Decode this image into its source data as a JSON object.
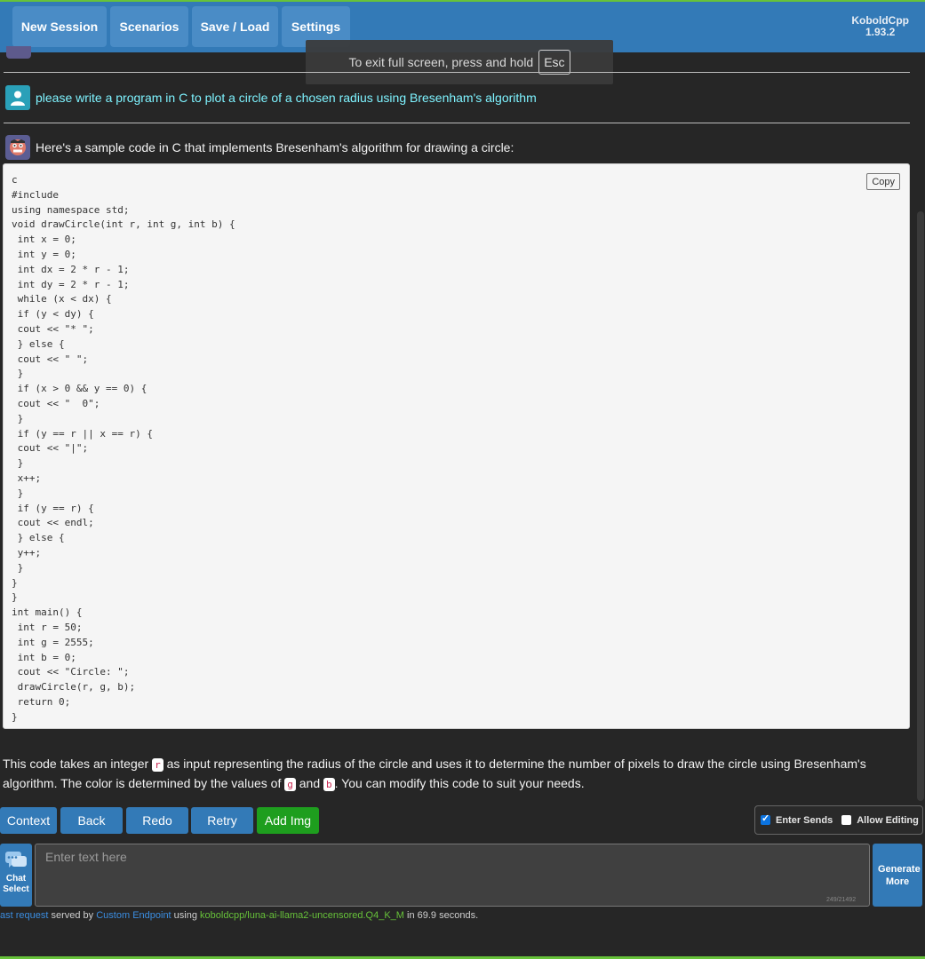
{
  "nav": {
    "new_session": "New Session",
    "scenarios": "Scenarios",
    "save_load": "Save / Load",
    "settings": "Settings"
  },
  "brand": {
    "name": "KoboldCpp",
    "version": "1.93.2"
  },
  "fullscreen_notice": {
    "text": "To exit full screen, press and hold",
    "key": "Esc"
  },
  "messages": {
    "user": "please write a program in C to plot a circle of a chosen radius using Bresenham's algorithm",
    "bot_intro": "Here's a sample code in C that implements Bresenham's algorithm for drawing a circle:",
    "code_copy_label": "Copy",
    "code": "c\n#include\nusing namespace std;\nvoid drawCircle(int r, int g, int b) {\n int x = 0;\n int y = 0;\n int dx = 2 * r - 1;\n int dy = 2 * r - 1;\n while (x < dx) {\n if (y < dy) {\n cout << \"* \";\n } else {\n cout << \" \";\n }\n if (x > 0 && y == 0) {\n cout << \"  0\";\n }\n if (y == r || x == r) {\n cout << \"|\";\n }\n x++;\n }\n if (y == r) {\n cout << endl;\n } else {\n y++;\n }\n}\n}\nint main() {\n int r = 50;\n int g = 2555;\n int b = 0;\n cout << \"Circle: \";\n drawCircle(r, g, b);\n return 0;\n}",
    "explain_1": "This code takes an integer ",
    "explain_code_r": "r",
    "explain_2": " as input representing the radius of the circle and uses it to determine the number of pixels to draw the circle using Bresenham's algorithm. The color is determined by the values of ",
    "explain_code_g": "g",
    "explain_3": " and ",
    "explain_code_b": "b",
    "explain_4": ". You can modify this code to suit your needs."
  },
  "actions": {
    "context": "Context",
    "back": "Back",
    "redo": "Redo",
    "retry": "Retry",
    "add_img": "Add Img"
  },
  "options": {
    "enter_sends": "Enter Sends",
    "enter_sends_checked": true,
    "allow_editing": "Allow Editing",
    "allow_editing_checked": false
  },
  "input": {
    "chat_select_1": "Chat",
    "chat_select_2": "Select",
    "placeholder": "Enter text here",
    "value": "",
    "counter": "249/21492",
    "generate_more_1": "Generate",
    "generate_more_2": "More"
  },
  "status": {
    "last_request": "ast request",
    "served_by": " served by ",
    "endpoint": "Custom Endpoint",
    "using": " using ",
    "model": "koboldcpp/luna-ai-llama2-uncensored.Q4_K_M",
    "duration": " in 69.9 seconds."
  },
  "colors": {
    "accent": "#337ab7",
    "success": "#1e9e1e",
    "user_text": "#7ef3ff"
  }
}
